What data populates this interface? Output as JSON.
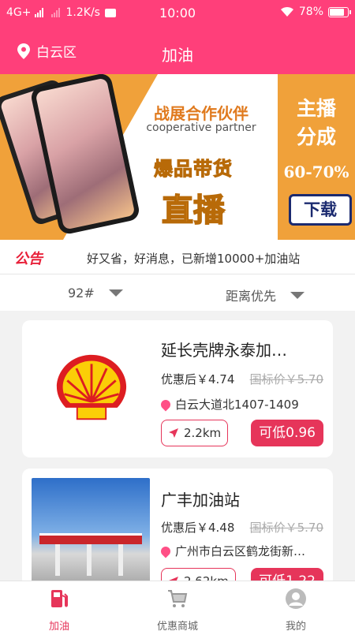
{
  "status_bar": {
    "network": "4G+",
    "speed": "1.2K/s",
    "time": "10:00",
    "battery": "78%"
  },
  "header": {
    "location": "白云区",
    "title": "加油"
  },
  "banner": {
    "partner_cn": "战展合作伙伴",
    "partner_en": "cooperative partner",
    "tag1": "爆品带货",
    "tag2": "直播",
    "right_line1": "主播",
    "right_line2": "分成",
    "commission": "60-70%",
    "download": "下载"
  },
  "notice": {
    "badge": "公告",
    "text": "好又省，好消息，已新增10000+加油站"
  },
  "filters": {
    "fuel": "92#",
    "sort": "距离优先"
  },
  "stations": [
    {
      "name": "延长壳牌永泰加…",
      "price": "优惠后￥4.74",
      "original": "国标价￥5.70",
      "address": "白云大道北1407-1409",
      "distance": "2.2km",
      "save": "可低0.96",
      "logo_color": "#dd1d21",
      "logo_fill": "#fbce07"
    },
    {
      "name": "广丰加油站",
      "price": "优惠后￥4.48",
      "original": "国标价￥5.70",
      "address": "广州市白云区鹤龙街新…",
      "distance": "2.62km",
      "save": "可低1.22"
    }
  ],
  "tabbar": {
    "tabs": [
      {
        "label": "加油",
        "active": true
      },
      {
        "label": "优惠商城",
        "active": false
      },
      {
        "label": "我的",
        "active": false
      }
    ]
  },
  "colors": {
    "brand": "#ff3f7a",
    "accent": "#e6355a",
    "banner_orange": "#f0a13a"
  }
}
